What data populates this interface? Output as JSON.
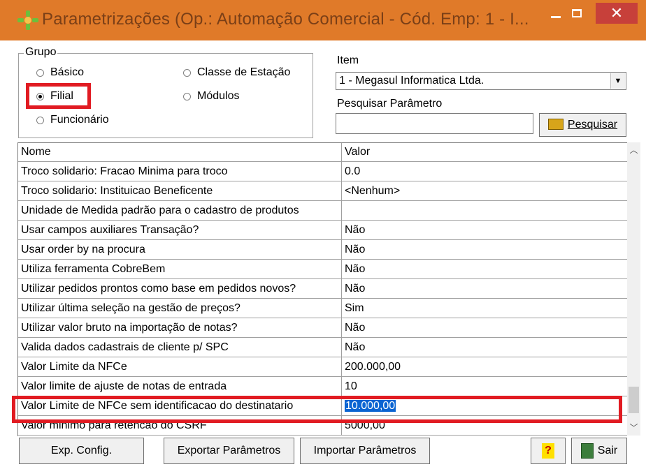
{
  "window": {
    "title": "Parametrizações (Op.: Automação Comercial - Cód. Emp: 1 - I...",
    "close_glyph": "✕"
  },
  "grupo": {
    "label": "Grupo",
    "options": [
      "Básico",
      "Classe de Estação",
      "Filial",
      "Módulos",
      "Funcionário"
    ],
    "selected": "Filial"
  },
  "item": {
    "label": "Item",
    "value": "1 - Megasul Informatica Ltda."
  },
  "search": {
    "label": "Pesquisar Parâmetro",
    "value": "",
    "button_label": "Pesquisar"
  },
  "grid": {
    "columns": [
      "Nome",
      "Valor"
    ],
    "rows": [
      {
        "nome": "Troco solidario: Fracao Minima para troco",
        "valor": "0.0"
      },
      {
        "nome": "Troco solidario: Instituicao Beneficente",
        "valor": "<Nenhum>"
      },
      {
        "nome": "Unidade de Medida padrão para o cadastro de produtos",
        "valor": ""
      },
      {
        "nome": "Usar campos auxiliares Transação?",
        "valor": "Não"
      },
      {
        "nome": "Usar order by na procura",
        "valor": "Não"
      },
      {
        "nome": "Utiliza ferramenta CobreBem",
        "valor": "Não"
      },
      {
        "nome": "Utilizar pedidos prontos como base em pedidos novos?",
        "valor": "Não"
      },
      {
        "nome": "Utilizar última seleção na gestão de preços?",
        "valor": "Sim"
      },
      {
        "nome": "Utilizar valor bruto na importação de notas?",
        "valor": "Não"
      },
      {
        "nome": "Valida dados cadastrais de cliente p/ SPC",
        "valor": "Não"
      },
      {
        "nome": "Valor Limite da NFCe",
        "valor": "200.000,00"
      },
      {
        "nome": "Valor limite de ajuste de notas de entrada",
        "valor": "10"
      },
      {
        "nome": "Valor Limite de NFCe sem identificacao do destinatario",
        "valor": "10.000,00"
      },
      {
        "nome": "Valor minimo para retencao do CSRF",
        "valor": "5000,00"
      }
    ],
    "selected_row": 12
  },
  "buttons": {
    "exp_config": "Exp. Config.",
    "exportar": "Exportar Parâmetros",
    "importar": "Importar Parâmetros",
    "help": "?",
    "sair": "Sair"
  },
  "colors": {
    "titlebar": "#e07a29",
    "close": "#c7403a",
    "highlight": "#e11b22",
    "selection": "#0a64d2"
  }
}
